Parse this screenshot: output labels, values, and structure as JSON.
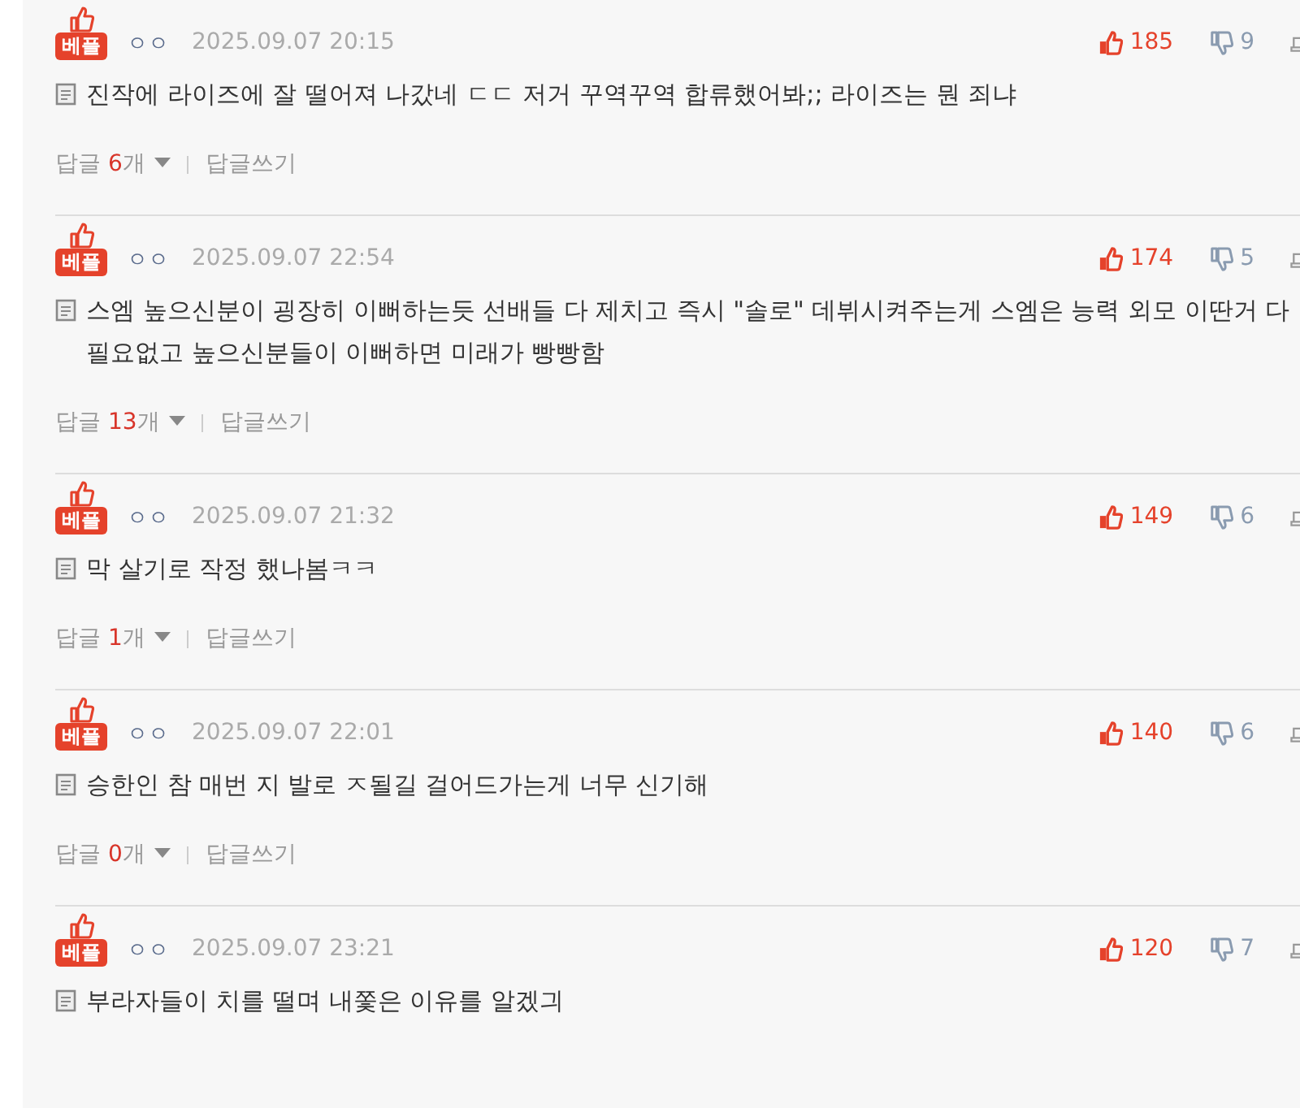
{
  "comments": [
    {
      "badge": "베플",
      "nickname": "ㅇㅇ",
      "date": "2025.09.07 20:15",
      "likes": "185",
      "dislikes": "9",
      "text": "진작에 라이즈에 잘 떨어져 나갔네 ㄷㄷ 저거 꾸역꾸역 합류했어봐;; 라이즈는 뭔 죄냐",
      "reply_label": "답글",
      "reply_count": "6",
      "reply_unit": "개",
      "write_reply": "답글쓰기"
    },
    {
      "badge": "베플",
      "nickname": "ㅇㅇ",
      "date": "2025.09.07 22:54",
      "likes": "174",
      "dislikes": "5",
      "text": "스엠 높으신분이 굉장히 이뻐하는듯 선배들 다 제치고 즉시 \"솔로\" 데뷔시켜주는게 스엠은 능력 외모 이딴거 다 필요없고 높으신분들이 이뻐하면 미래가 빵빵함",
      "reply_label": "답글",
      "reply_count": "13",
      "reply_unit": "개",
      "write_reply": "답글쓰기"
    },
    {
      "badge": "베플",
      "nickname": "ㅇㅇ",
      "date": "2025.09.07 21:32",
      "likes": "149",
      "dislikes": "6",
      "text": "막 살기로 작정 했나봄ㅋㅋ",
      "reply_label": "답글",
      "reply_count": "1",
      "reply_unit": "개",
      "write_reply": "답글쓰기"
    },
    {
      "badge": "베플",
      "nickname": "ㅇㅇ",
      "date": "2025.09.07 22:01",
      "likes": "140",
      "dislikes": "6",
      "text": "승한인 참 매번 지 발로 ㅈ될길 걸어드가는게 너무 신기해",
      "reply_label": "답글",
      "reply_count": "0",
      "reply_unit": "개",
      "write_reply": "답글쓰기"
    },
    {
      "badge": "베플",
      "nickname": "ㅇㅇ",
      "date": "2025.09.07 23:21",
      "likes": "120",
      "dislikes": "7",
      "text": "부라자들이 치를 떨며 내쫓은 이유를 알겠긔"
    }
  ]
}
